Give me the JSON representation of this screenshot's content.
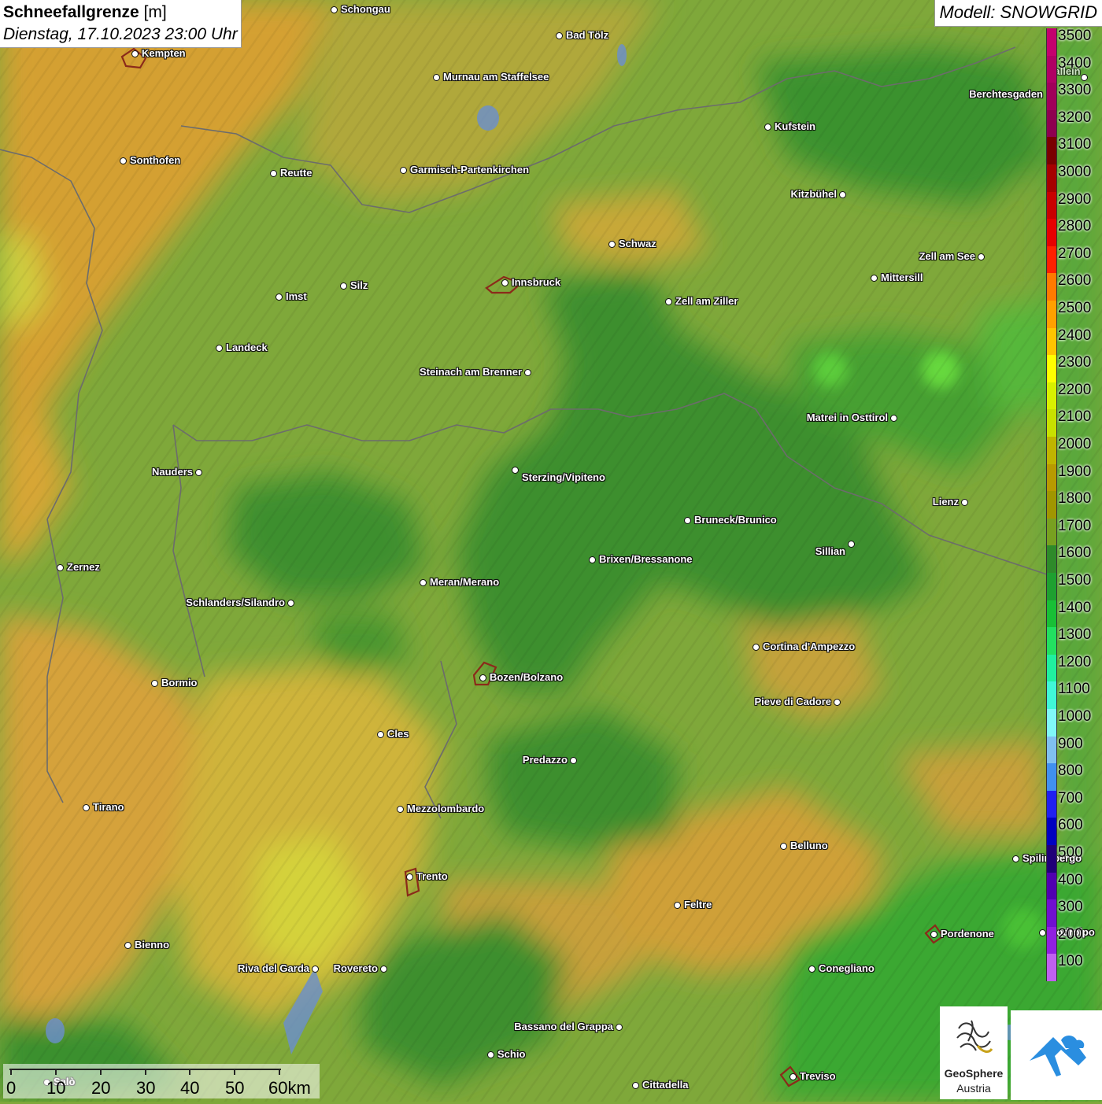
{
  "header": {
    "title": "Schneefallgrenze",
    "unit": "[m]",
    "datetime": "Dienstag, 17.10.2023 23:00 Uhr"
  },
  "model_label": "Modell: SNOWGRID",
  "legend": {
    "levels": [
      "3500",
      "3400",
      "3300",
      "3200",
      "3100",
      "3000",
      "2900",
      "2800",
      "2700",
      "2600",
      "2500",
      "2400",
      "2300",
      "2200",
      "2100",
      "2000",
      "1900",
      "1800",
      "1700",
      "1600",
      "1500",
      "1400",
      "1300",
      "1200",
      "1100",
      "1000",
      "900",
      "800",
      "700",
      "600",
      "500",
      "400",
      "300",
      "200",
      "100"
    ],
    "colors": [
      "#c4006e",
      "#b00064",
      "#a0005a",
      "#8e0050",
      "#7a0000",
      "#a60000",
      "#c80000",
      "#e60000",
      "#ff2000",
      "#ff7a00",
      "#ffa000",
      "#ffc400",
      "#ffff00",
      "#d8f000",
      "#c8e000",
      "#c0b400",
      "#b89a00",
      "#a09600",
      "#78a020",
      "#2e8a2a",
      "#1ea030",
      "#18c036",
      "#22e060",
      "#20f0a0",
      "#40f8d8",
      "#80f8f8",
      "#80c0f0",
      "#4090f0",
      "#2020f0",
      "#0000c0",
      "#200078",
      "#5000b0",
      "#7010d0",
      "#9020e0",
      "#c060f0"
    ]
  },
  "cities": [
    {
      "name": "Schongau"
    },
    {
      "name": "Kempten"
    },
    {
      "name": "Bad Tölz"
    },
    {
      "name": "Murnau am Staffelsee"
    },
    {
      "name": "Kufstein"
    },
    {
      "name": "Berchtesgaden"
    },
    {
      "name": "Sonthofen"
    },
    {
      "name": "Reutte"
    },
    {
      "name": "Garmisch-Partenkirchen"
    },
    {
      "name": "Kitzbühel"
    },
    {
      "name": "Schwaz"
    },
    {
      "name": "Zell am See"
    },
    {
      "name": "Mittersill"
    },
    {
      "name": "Innsbruck"
    },
    {
      "name": "Silz"
    },
    {
      "name": "Imst"
    },
    {
      "name": "Zell am Ziller"
    },
    {
      "name": "Landeck"
    },
    {
      "name": "Steinach am Brenner"
    },
    {
      "name": "Matrei in Osttirol"
    },
    {
      "name": "Nauders"
    },
    {
      "name": "Sterzing/Vipiteno"
    },
    {
      "name": "Lienz"
    },
    {
      "name": "Bruneck/Brunico"
    },
    {
      "name": "Sillian"
    },
    {
      "name": "Zernez"
    },
    {
      "name": "Brixen/Bressanone"
    },
    {
      "name": "Meran/Merano"
    },
    {
      "name": "Schlanders/Silandro"
    },
    {
      "name": "Cortina d'Ampezzo"
    },
    {
      "name": "Bozen/Bolzano"
    },
    {
      "name": "Bormio"
    },
    {
      "name": "Pieve di Cadore"
    },
    {
      "name": "Cles"
    },
    {
      "name": "Predazzo"
    },
    {
      "name": "Tirano"
    },
    {
      "name": "Mezzolombardo"
    },
    {
      "name": "Belluno"
    },
    {
      "name": "Spilimbergo"
    },
    {
      "name": "Trento"
    },
    {
      "name": "Feltre"
    },
    {
      "name": "Pordenone"
    },
    {
      "name": "Bienno"
    },
    {
      "name": "Riva del Garda"
    },
    {
      "name": "Rovereto"
    },
    {
      "name": "Conegliano"
    },
    {
      "name": "Bassano del Grappa"
    },
    {
      "name": "Schio"
    },
    {
      "name": "Treviso"
    },
    {
      "name": "Cittadella"
    },
    {
      "name": "Hallein"
    },
    {
      "name": "Codroipo"
    },
    {
      "name": "Salò"
    }
  ],
  "scale": {
    "ticks": [
      "0",
      "10",
      "20",
      "30",
      "40",
      "50",
      "60km"
    ]
  },
  "logos": {
    "geosphere_line1": "GeoSphere",
    "geosphere_line2": "Austria"
  },
  "icons": {
    "geosphere": "geosphere-logo-icon",
    "partner": "mountain-cloud-logo-icon"
  }
}
